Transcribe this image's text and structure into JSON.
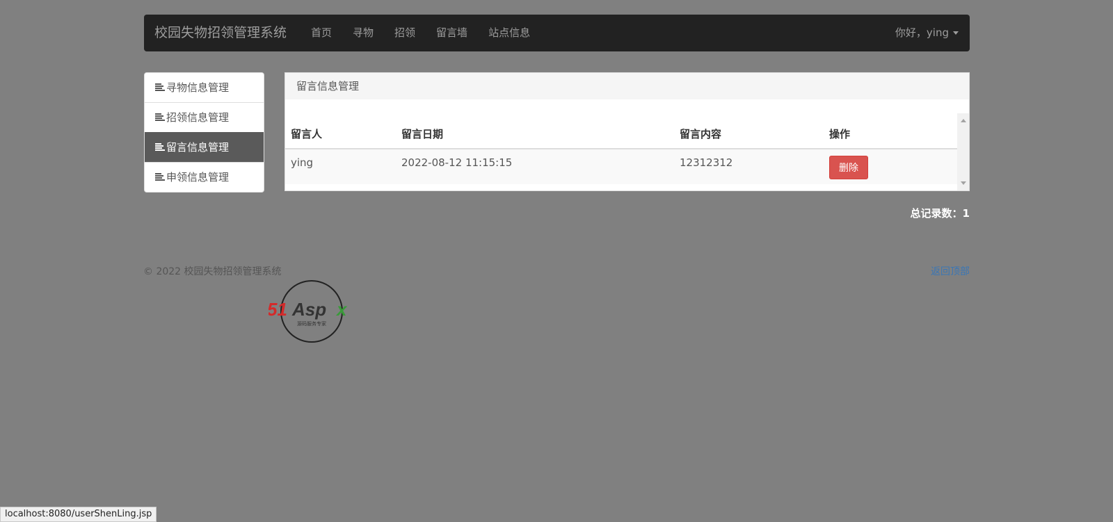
{
  "navbar": {
    "brand": "校园失物招领管理系统",
    "links": [
      "首页",
      "寻物",
      "招领",
      "留言墙",
      "站点信息"
    ],
    "user": "你好，ying"
  },
  "sidebar": {
    "items": [
      {
        "label": "寻物信息管理"
      },
      {
        "label": "招领信息管理"
      },
      {
        "label": "留言信息管理"
      },
      {
        "label": "申领信息管理"
      }
    ],
    "active_index": 2
  },
  "panel": {
    "heading": "留言信息管理",
    "columns": [
      "留言人",
      "留言日期",
      "留言内容",
      "操作"
    ],
    "rows": [
      {
        "author": "ying",
        "date": "2022-08-12 11:15:15",
        "content": "12312312",
        "action": "删除"
      }
    ]
  },
  "total": "总记录数：1",
  "footer": {
    "copyright": "© 2022 校园失物招领管理系统",
    "back_to_top": "返回顶部"
  },
  "watermark": {
    "logo_text": "51Aspx",
    "tagline": "源码服务专家"
  },
  "status_url": "localhost:8080/userShenLing.jsp",
  "colors": {
    "navbar_bg": "#222222",
    "active_item": "#5a5a5a",
    "delete_button": "#d9534f",
    "link": "#3a76b5"
  }
}
